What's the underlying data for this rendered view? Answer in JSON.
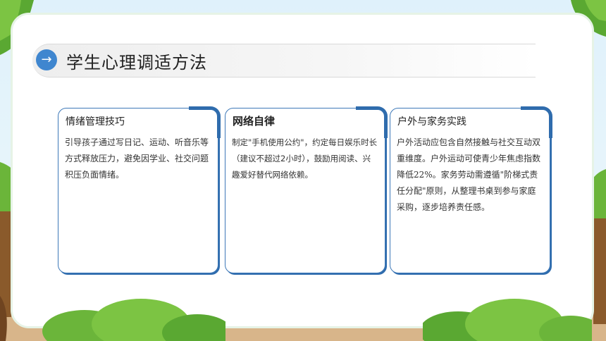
{
  "slide": {
    "title": "学生心理调适方法",
    "title_icon": "arrow-right-icon",
    "accent_color": "#3f86cf"
  },
  "cards": [
    {
      "title": "情绪管理技巧",
      "body": "引导孩子通过写日记、运动、听音乐等方式释放压力，避免因学业、社交问题积压负面情绪。"
    },
    {
      "title": "网络自律",
      "body": "制定\"手机使用公约\"，约定每日娱乐时长（建议不超过2小时），鼓励用阅读、兴趣爱好替代网络依赖。"
    },
    {
      "title": "户外与家务实践",
      "body": "户外活动应包含自然接触与社交互动双重维度。户外运动可使青少年焦虑指数降低22%。家务劳动需遵循\"阶梯式责任分配\"原则，从整理书桌到参与家庭采购，逐步培养责任感。"
    }
  ]
}
